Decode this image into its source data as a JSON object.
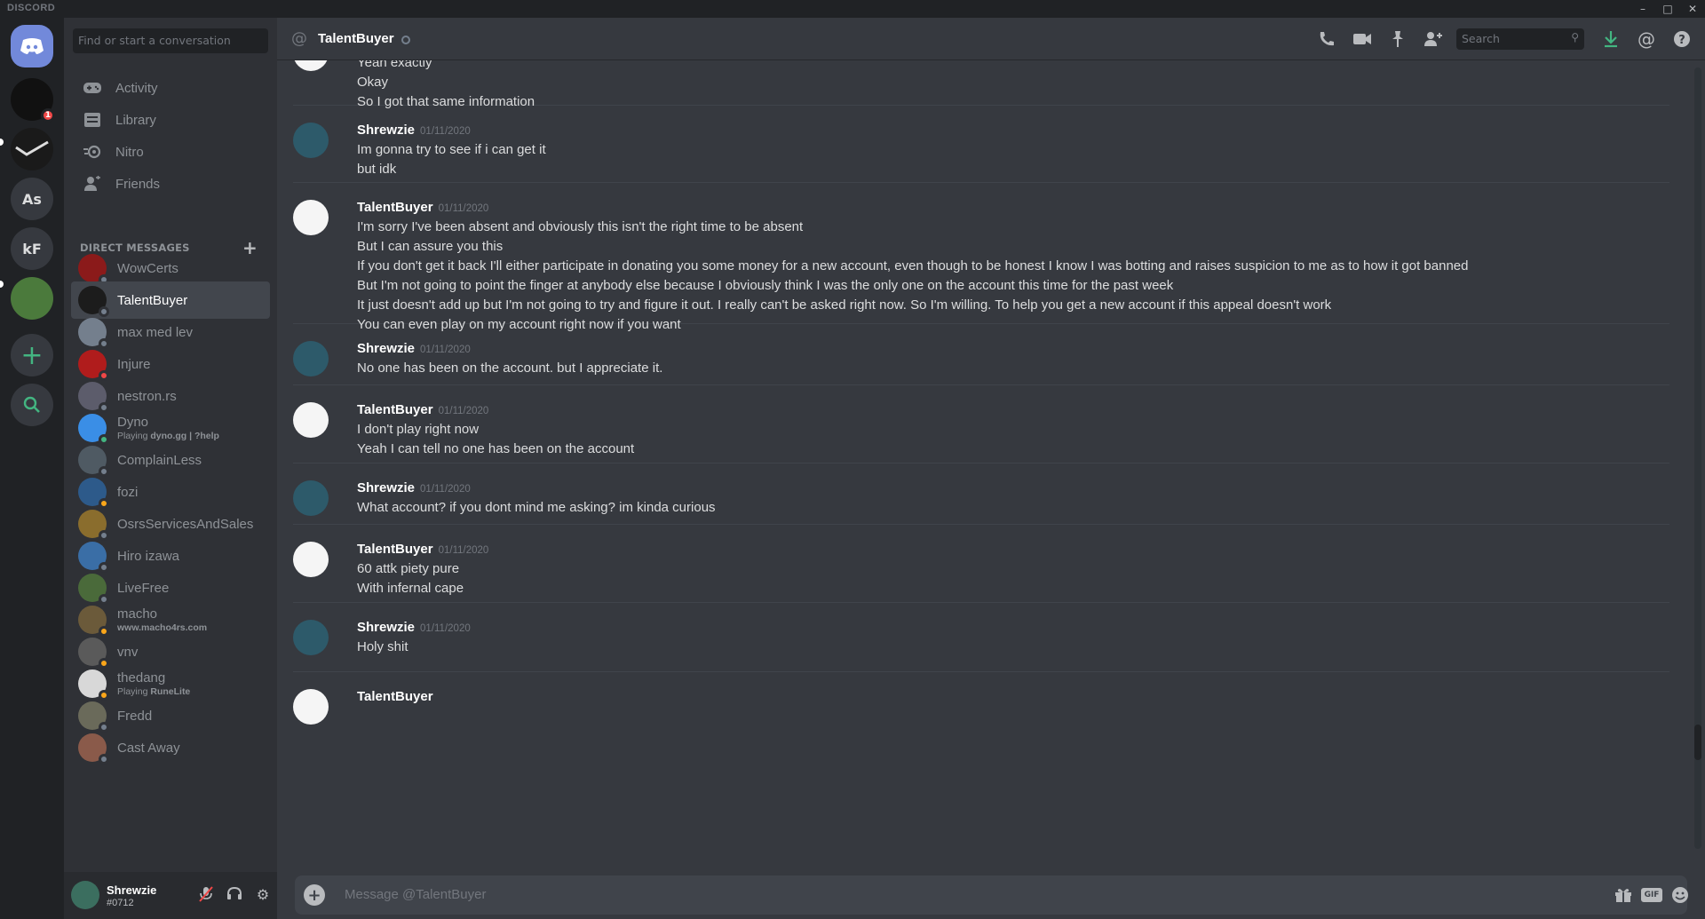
{
  "window": {
    "brand": "DISCORD"
  },
  "guilds": [
    {
      "label": "",
      "badge": "1"
    },
    {
      "label": ""
    },
    {
      "label": "As"
    },
    {
      "label": "kF"
    },
    {
      "label": ""
    }
  ],
  "sidebar": {
    "search_placeholder": "Find or start a conversation",
    "nav": [
      {
        "label": "Activity"
      },
      {
        "label": "Library"
      },
      {
        "label": "Nitro"
      },
      {
        "label": "Friends"
      }
    ],
    "dm_header": "DIRECT MESSAGES",
    "dms": [
      {
        "name": "WowCerts",
        "status": "offline",
        "color": "#8b1a1a"
      },
      {
        "name": "TalentBuyer",
        "status": "offline",
        "color": "#1c1c1c",
        "active": true
      },
      {
        "name": "max med lev",
        "status": "offline",
        "color": "#747f8d"
      },
      {
        "name": "Injure",
        "status": "dnd",
        "color": "#b01c1c"
      },
      {
        "name": "nestron.rs",
        "status": "offline",
        "color": "#5c5c6b"
      },
      {
        "name": "Dyno",
        "status": "online",
        "color": "#3a8ee6",
        "sub_prefix": "Playing ",
        "sub_bold": "dyno.gg | ?help"
      },
      {
        "name": "ComplainLess",
        "status": "offline",
        "color": "#4f5a63"
      },
      {
        "name": "fozi",
        "status": "idle",
        "color": "#2d5a8a"
      },
      {
        "name": "OsrsServicesAndSales",
        "status": "offline",
        "color": "#8a6d2d"
      },
      {
        "name": "Hiro izawa",
        "status": "offline",
        "color": "#3a6ea6"
      },
      {
        "name": "LiveFree",
        "status": "offline",
        "color": "#4a6a3a"
      },
      {
        "name": "macho",
        "status": "idle",
        "color": "#6b5a3a",
        "sub_prefix": "",
        "sub_bold": "www.macho4rs.com"
      },
      {
        "name": "vnv",
        "status": "idle",
        "color": "#5a5a5a"
      },
      {
        "name": "thedang",
        "status": "idle",
        "color": "#d8d8d8",
        "sub_prefix": "Playing ",
        "sub_bold": "RuneLite"
      },
      {
        "name": "Fredd",
        "status": "offline",
        "color": "#6a6a5a"
      },
      {
        "name": "Cast Away",
        "status": "offline",
        "color": "#8a5a4a"
      }
    ]
  },
  "user": {
    "name": "Shrewzie",
    "tag": "#0712"
  },
  "header": {
    "title": "TalentBuyer",
    "search_placeholder": "Search"
  },
  "messages": [
    {
      "author": "",
      "timestamp": "",
      "lines": [
        "Yeah exactly",
        "Okay",
        "So I got that same information"
      ]
    },
    {
      "author": "Shrewzie",
      "timestamp": "01/11/2020",
      "lines": [
        "Im gonna try to see if i can get it",
        "but idk"
      ]
    },
    {
      "author": "TalentBuyer",
      "timestamp": "01/11/2020",
      "lines": [
        "I'm sorry I've been absent and obviously this isn't the right time to be absent",
        "But I can assure you this",
        "If you don't get it back I'll either participate in donating you some money for a new account, even though to be honest I know I was botting and raises suspicion to me as to how it got banned",
        "But I'm not going to point the finger at anybody else because I obviously think I was the only one on the account this time for the past week",
        "It just doesn't add up but I'm not going to try and figure it out. I really can't be asked right now. So I'm willing. To help you get a new account if this appeal doesn't work",
        "You can even play on my account right now if you want"
      ]
    },
    {
      "author": "Shrewzie",
      "timestamp": "01/11/2020",
      "lines": [
        "No one has been on the account. but I appreciate it."
      ]
    },
    {
      "author": "TalentBuyer",
      "timestamp": "01/11/2020",
      "lines": [
        "I don't play right now",
        "Yeah I can tell no one has been on the account"
      ]
    },
    {
      "author": "Shrewzie",
      "timestamp": "01/11/2020",
      "lines": [
        "What account? if you dont mind me asking? im kinda curious"
      ]
    },
    {
      "author": "TalentBuyer",
      "timestamp": "01/11/2020",
      "lines": [
        "60 attk piety pure",
        "With infernal cape"
      ]
    },
    {
      "author": "Shrewzie",
      "timestamp": "01/11/2020",
      "lines": [
        "Holy shit"
      ]
    },
    {
      "author": "TalentBuyer",
      "timestamp": "",
      "lines": []
    }
  ],
  "composer": {
    "placeholder": "Message @TalentBuyer",
    "gif_label": "GIF"
  },
  "colors": {
    "accent": "#7289da",
    "online": "#43b581",
    "idle": "#faa61a",
    "dnd": "#f04747"
  }
}
